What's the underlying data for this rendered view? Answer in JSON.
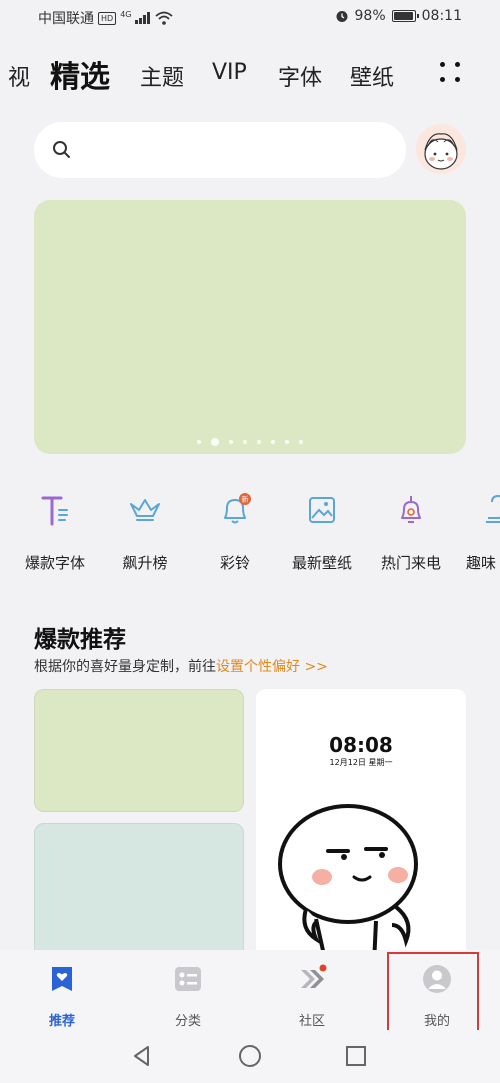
{
  "status_bar": {
    "carrier": "中国联通",
    "hd_badge": "HD",
    "network": "4G",
    "battery": "98%",
    "battery_level": 0.98,
    "time": "08:11"
  },
  "top_tabs": {
    "items": [
      "视",
      "精选",
      "主题",
      "VIP",
      "字体",
      "壁纸"
    ],
    "active_index": 1
  },
  "search": {
    "placeholder": ""
  },
  "banner": {
    "page_count": 8,
    "active_page": 1,
    "bg_color": "#dce7c3"
  },
  "categories": [
    {
      "label": "爆款字体",
      "icon": "font-icon"
    },
    {
      "label": "飙升榜",
      "icon": "crown-icon"
    },
    {
      "label": "彩铃",
      "icon": "bell-icon",
      "badge": "新"
    },
    {
      "label": "最新壁纸",
      "icon": "wallpaper-icon"
    },
    {
      "label": "热门来电",
      "icon": "ringing-bell-icon"
    },
    {
      "label": "趣味",
      "icon": "fun-icon"
    }
  ],
  "section": {
    "title": "爆款推荐",
    "subtitle": "根据你的喜好量身定制，前往",
    "link": "设置个性偏好 >>"
  },
  "preview_card": {
    "time": "08:08",
    "date": "12月12日 星期一"
  },
  "bottom_nav": {
    "items": [
      {
        "label": "推荐",
        "icon": "heart-bookmark-icon",
        "active": true
      },
      {
        "label": "分类",
        "icon": "category-list-icon",
        "active": false
      },
      {
        "label": "社区",
        "icon": "community-chevrons-icon",
        "active": false,
        "dot": true
      },
      {
        "label": "我的",
        "icon": "profile-avatar-icon",
        "active": false
      }
    ]
  },
  "colors": {
    "accent": "#2a63d6",
    "link": "#e08a1e",
    "highlight_box": "#d63a3a",
    "icon_blue": "#5aa6d8",
    "icon_purple": "#9a6ad0"
  }
}
